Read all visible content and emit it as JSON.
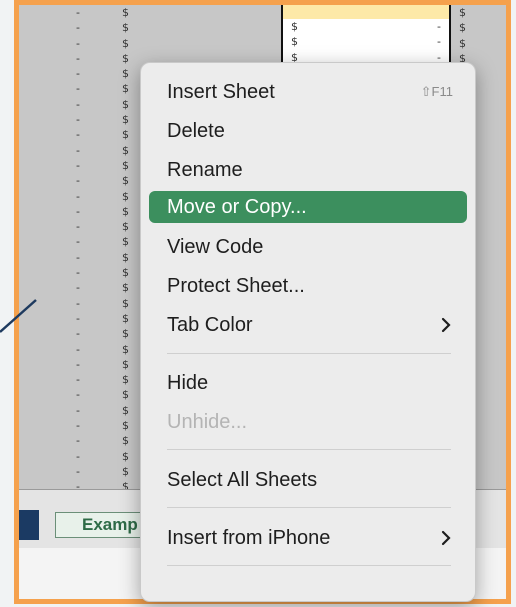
{
  "sheet": {
    "dash_cells": [
      "-",
      "-",
      "-",
      "-",
      "-",
      "-",
      "-",
      "-",
      "-",
      "-",
      "-",
      "-",
      "-",
      "-",
      "-",
      "-",
      "-",
      "-",
      "-",
      "-",
      "-",
      "-",
      "-",
      "-",
      "-",
      "-",
      "-",
      "-",
      "-",
      "-",
      "-",
      "-"
    ],
    "dollar_cells": [
      "$",
      "$",
      "$",
      "$",
      "$",
      "$",
      "$",
      "$",
      "$",
      "$",
      "$",
      "$",
      "$",
      "$",
      "$",
      "$",
      "$",
      "$",
      "$",
      "$",
      "$",
      "$",
      "$",
      "$",
      "$",
      "$",
      "$",
      "$",
      "$",
      "$",
      "$",
      "$",
      "$"
    ],
    "selected_cells": [
      {
        "a": "$",
        "b": "-"
      },
      {
        "a": "$",
        "b": "-"
      },
      {
        "a": "$",
        "b": "-"
      }
    ],
    "right_cells": [
      "$",
      "$",
      "$",
      "$",
      "$",
      "$",
      "$",
      "$",
      "$",
      "$",
      "$",
      "$",
      "$",
      "$",
      "$",
      "$",
      "$",
      "$",
      "$",
      "$",
      "$",
      "$",
      "$",
      "$",
      "$",
      "$",
      "$",
      "$",
      "$",
      "$",
      "$",
      "$"
    ]
  },
  "tabs": {
    "example_label": "Examp"
  },
  "menu": {
    "items": [
      {
        "label": "Insert Sheet",
        "shortcut": "⇧F11"
      },
      {
        "label": "Delete"
      },
      {
        "label": "Rename"
      },
      {
        "label": "Move or Copy..."
      },
      {
        "label": "View Code"
      },
      {
        "label": "Protect Sheet..."
      },
      {
        "label": "Tab Color",
        "submenu_icon": "chevron-right-icon"
      },
      {
        "label": "Hide"
      },
      {
        "label": "Unhide..."
      },
      {
        "label": "Select All Sheets"
      },
      {
        "label": "Insert from iPhone",
        "submenu_icon": "chevron-right-icon"
      }
    ],
    "active_color": "#3c8f5e"
  }
}
